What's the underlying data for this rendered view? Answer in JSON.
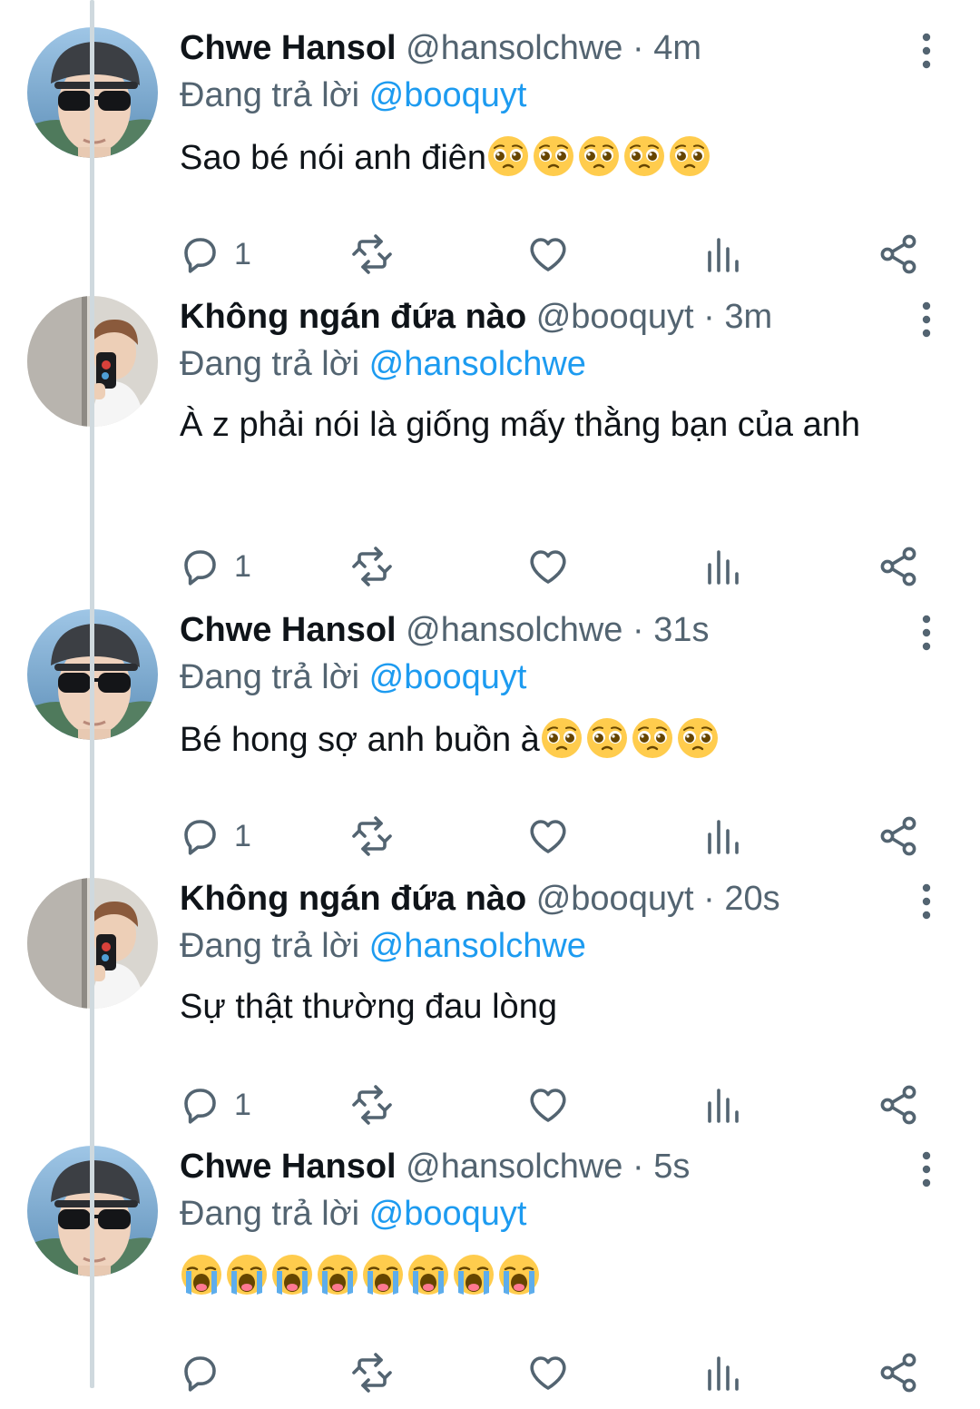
{
  "reply_prefix": "Đang trả lời",
  "tweets": [
    {
      "display_name": "Chwe Hansol",
      "handle": "@hansolchwe",
      "time": "4m",
      "replying_to": "@booquyt",
      "text": "Sao bé nói anh điên",
      "emoji": "pleading-face",
      "emoji_count": 5,
      "reply_count": "1",
      "avatar": "sunglasses-cap-avatar"
    },
    {
      "display_name": "Không ngán đứa nào",
      "handle": "@booquyt",
      "time": "3m",
      "replying_to": "@hansolchwe",
      "text": "À z phải nói là giống mấy thằng bạn của anh",
      "reply_count": "1",
      "avatar": "mirror-selfie-avatar"
    },
    {
      "display_name": "Chwe Hansol",
      "handle": "@hansolchwe",
      "time": "31s",
      "replying_to": "@booquyt",
      "text": "Bé hong sợ anh buồn à",
      "emoji": "pleading-face",
      "emoji_count": 4,
      "reply_count": "1",
      "avatar": "sunglasses-cap-avatar"
    },
    {
      "display_name": "Không ngán đứa nào",
      "handle": "@booquyt",
      "time": "20s",
      "replying_to": "@hansolchwe",
      "text": "Sự thật thường đau lòng",
      "reply_count": "1",
      "avatar": "mirror-selfie-avatar"
    },
    {
      "display_name": "Chwe Hansol",
      "handle": "@hansolchwe",
      "time": "5s",
      "replying_to": "@booquyt",
      "text": "",
      "emoji": "loudly-crying-face",
      "emoji_count": 8,
      "reply_count": "",
      "avatar": "sunglasses-cap-avatar"
    }
  ],
  "colors": {
    "text": "#0f1419",
    "muted": "#536471",
    "mention": "#1d9bf0",
    "thread_line": "#cfd9de"
  }
}
